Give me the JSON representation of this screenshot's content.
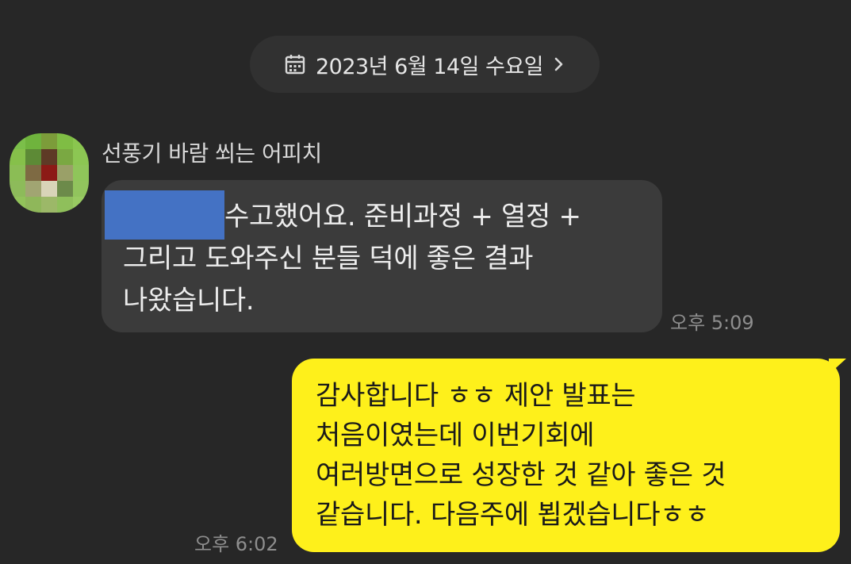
{
  "date_divider": {
    "icon": "calendar-icon",
    "text": "2023년 6월 14일 수요일",
    "chevron_icon": "chevron-right-icon"
  },
  "incoming": {
    "sender_name": "선풍기 바람 쐬는 어피치",
    "avatar": "blurred-avatar",
    "redaction_color": "#4472c4",
    "lines": [
      "수고했어요. 준비과정 + 열정 +",
      "그리고 도와주신 분들 덕에 좋은 결과",
      "나왔습니다."
    ],
    "time": "오후 5:09"
  },
  "outgoing": {
    "lines": [
      "감사합니다 ㅎㅎ 제안 발표는",
      "처음이였는데 이번기회에",
      "여러방면으로 성장한 것 같아 좋은 것",
      "같습니다. 다음주에 뵙겠습니다ㅎㅎ"
    ],
    "time": "오후 6:02",
    "bubble_color": "#fef01b"
  },
  "theme": {
    "background": "#272727",
    "incoming_bubble": "#3b3b3b"
  }
}
